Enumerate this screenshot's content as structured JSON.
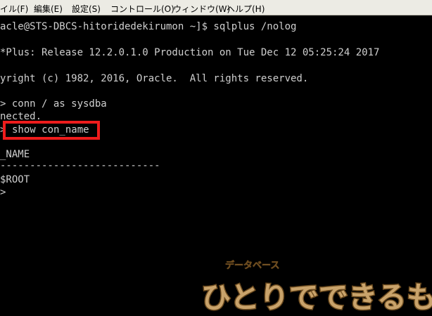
{
  "menu": [
    "イル(F)",
    "編集(E)",
    "設定(S)",
    "コントロール(O)",
    "ウィンドウ(W)",
    "ヘルプ(H)"
  ],
  "terminal": {
    "lines": [
      "acle@STS-DBCS-hitoridedekirumon ~]$ sqlplus /nolog",
      "*Plus: Release 12.2.0.1.0 Production on Tue Dec 12 05:25:24 2017",
      "yright (c) 1982, 2016, Oracle.  All rights reserved.",
      "> conn / as sysdba",
      "nected.",
      ">",
      "show con_name",
      "_NAME",
      "---------------------------",
      "$ROOT",
      ">"
    ]
  },
  "watermark": {
    "subtitle": "データベース",
    "title": "ひとりでできるもん"
  },
  "colors": {
    "highlight": "#ee1c1c",
    "terminal_bg": "#000000",
    "terminal_text": "#cfcfcf",
    "logo_brown": "#6b4a1e",
    "logo_tan": "#c9a36b"
  }
}
